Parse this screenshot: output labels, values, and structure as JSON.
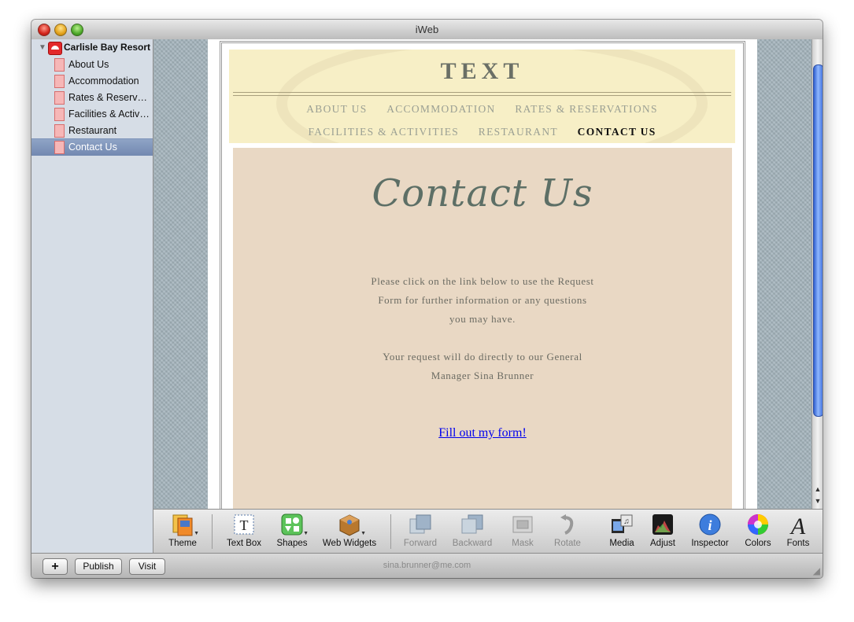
{
  "window": {
    "title": "iWeb"
  },
  "sidebar": {
    "site_name": "Carlisle Bay Resort",
    "pages": [
      {
        "label": "About Us",
        "selected": false
      },
      {
        "label": "Accommodation",
        "selected": false
      },
      {
        "label": "Rates & Reservations",
        "selected": false
      },
      {
        "label": "Facilities & Activities",
        "selected": false
      },
      {
        "label": "Restaurant",
        "selected": false
      },
      {
        "label": "Contact Us",
        "selected": true
      }
    ]
  },
  "webpage": {
    "site_title": "TEXT",
    "nav_row1": [
      "ABOUT US",
      "ACCOMMODATION",
      "RATES & RESERVATIONS"
    ],
    "nav_row2": [
      "FACILITIES & ACTIVITIES",
      "RESTAURANT",
      "CONTACT US"
    ],
    "current_nav": "CONTACT US",
    "heading": "Contact Us",
    "paragraph1": [
      "Please click on the link below to use the Request",
      "Form for further information or any questions",
      "you may have."
    ],
    "paragraph2": [
      "Your request will do directly to our General",
      "Manager Sina Brunner"
    ],
    "link": "Fill out my form!"
  },
  "toolbar": {
    "theme": "Theme",
    "text_box": "Text Box",
    "shapes": "Shapes",
    "web_widgets": "Web Widgets",
    "forward": "Forward",
    "backward": "Backward",
    "mask": "Mask",
    "rotate": "Rotate",
    "media": "Media",
    "adjust": "Adjust",
    "inspector": "Inspector",
    "colors": "Colors",
    "fonts": "Fonts"
  },
  "bottombar": {
    "add": "+",
    "publish": "Publish",
    "visit": "Visit",
    "account": "sina.brunner@me.com"
  },
  "colors": {
    "header_band": "#f7efc6",
    "content_panel": "#e9d8c4",
    "heading_color": "#5d6f66",
    "link_color": "#0000ee",
    "sidebar_selection": "#7f95bb"
  }
}
